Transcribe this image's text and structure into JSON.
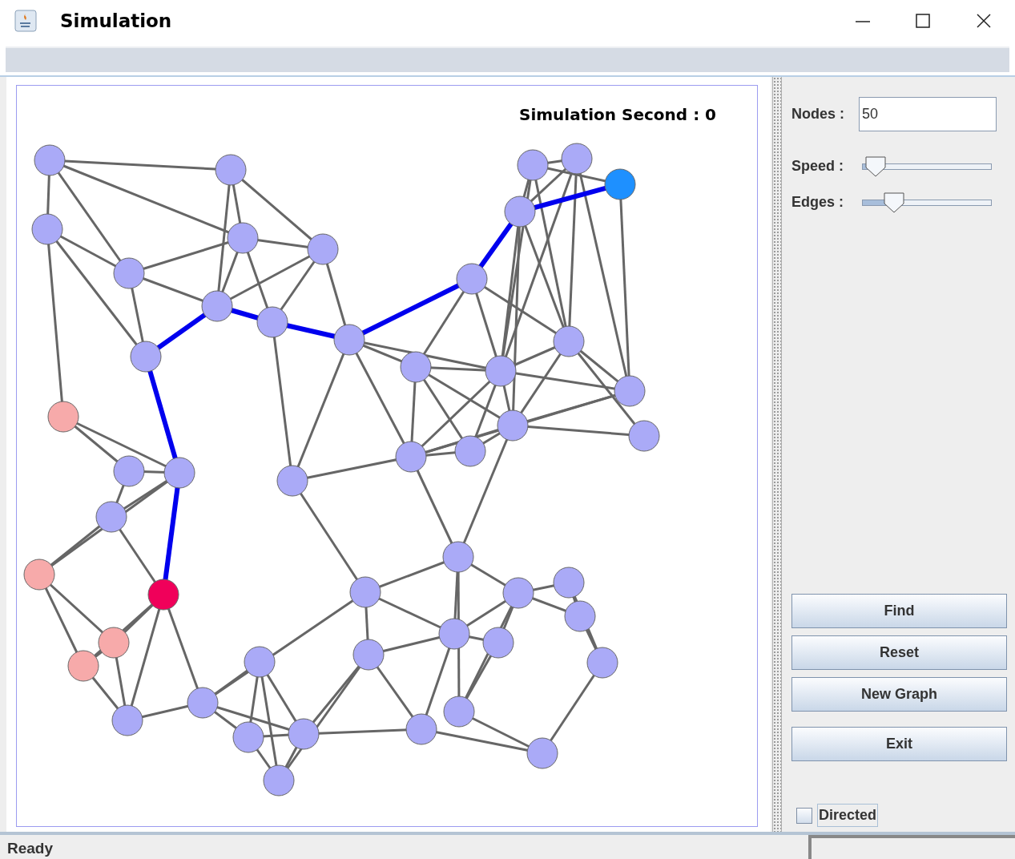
{
  "window": {
    "title": "Simulation"
  },
  "canvas": {
    "label": "Simulation Second : 0"
  },
  "controls": {
    "nodes": {
      "label": "Nodes :",
      "value": "50"
    },
    "sliders": [
      {
        "label": "Speed :",
        "level": 0.03
      },
      {
        "label": "Edges :",
        "level": 0.2
      }
    ],
    "buttons": [
      "Find",
      "Reset",
      "New Graph",
      "Exit"
    ],
    "directed": {
      "label": "Directed",
      "checked": false
    }
  },
  "status_bar": {
    "text": "Ready"
  }
}
